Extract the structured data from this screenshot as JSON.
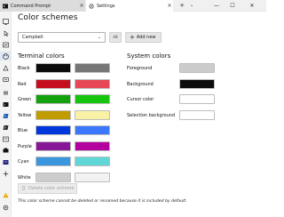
{
  "tabs": [
    {
      "label": "Command Prompt",
      "icon": "terminal-icon"
    },
    {
      "label": "Settings",
      "icon": "gear-icon"
    }
  ],
  "window": {
    "minimize": "—",
    "maximize": "☐",
    "close": "✕"
  },
  "sidebar": {
    "icons": [
      "launch-icon",
      "interaction-icon",
      "appearance-icon",
      "color-schemes-icon",
      "rendering-icon",
      "actions-icon",
      "profile-defaults-icon",
      "profile-cmd-icon",
      "profile-powershell-icon",
      "profile-pwsh-icon",
      "profile-terminal-icon",
      "profile-azure-icon",
      "profile-ubuntu-icon",
      "add-profile-icon",
      "warning-icon",
      "gear-icon"
    ]
  },
  "page": {
    "title": "Color schemes",
    "scheme_selected": "Campbell",
    "rename_btn": "AB",
    "add_new": "Add new",
    "delete_btn": "Delete color scheme",
    "note": "This color scheme cannot be deleted or renamed because it is included by default."
  },
  "terminal": {
    "title": "Terminal colors",
    "rows": [
      {
        "label": "Black",
        "normal": "#0c0c0c",
        "bright": "#767676"
      },
      {
        "label": "Red",
        "normal": "#c50f1f",
        "bright": "#e74856"
      },
      {
        "label": "Green",
        "normal": "#13a10e",
        "bright": "#16c60c"
      },
      {
        "label": "Yellow",
        "normal": "#c19c00",
        "bright": "#f9f1a5"
      },
      {
        "label": "Blue",
        "normal": "#0037da",
        "bright": "#3b78ff"
      },
      {
        "label": "Purple",
        "normal": "#881798",
        "bright": "#b4009e"
      },
      {
        "label": "Cyan",
        "normal": "#3a96dd",
        "bright": "#61d6d6"
      },
      {
        "label": "White",
        "normal": "#cccccc",
        "bright": "#f2f2f2"
      }
    ]
  },
  "system": {
    "title": "System colors",
    "rows": [
      {
        "label": "Foreground",
        "color": "#cccccc"
      },
      {
        "label": "Background",
        "color": "#0c0c0c"
      },
      {
        "label": "Cursor color",
        "color": "#ffffff"
      },
      {
        "label": "Selection background",
        "color": "#ffffff"
      }
    ]
  }
}
